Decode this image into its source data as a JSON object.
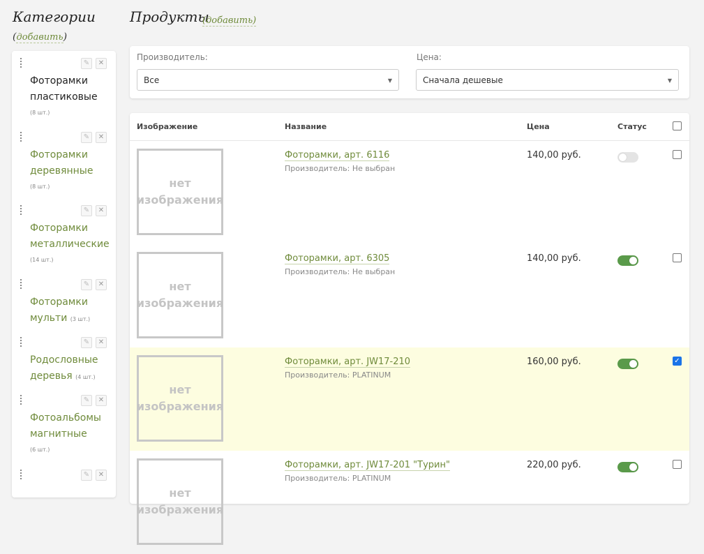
{
  "categories": {
    "title": "Категории",
    "add_open": "(",
    "add_label": "добавить",
    "add_close": ")",
    "items": [
      {
        "line1": "Фоторамки",
        "line2": "пластиковые",
        "inline_count": "",
        "count": "(8 шт.)",
        "active": true
      },
      {
        "line1": "Фоторамки",
        "line2": "деревянные",
        "inline_count": "",
        "count": "(8 шт.)",
        "active": false
      },
      {
        "line1": "Фоторамки",
        "line2": "металлические",
        "inline_count": "",
        "count": "(14 шт.)",
        "active": false
      },
      {
        "line1": "Фоторамки",
        "line2": "мульти",
        "inline_count": "(3 шт.)",
        "count": "",
        "active": false
      },
      {
        "line1": "Родословные",
        "line2": "деревья",
        "inline_count": "(4 шт.)",
        "count": "",
        "active": false
      },
      {
        "line1": "Фотоальбомы",
        "line2": "магнитные",
        "inline_count": "",
        "count": "(6 шт.)",
        "active": false
      }
    ],
    "edit_icon": "pencil-icon",
    "delete_icon": "close-icon",
    "delete_glyph": "✕",
    "edit_glyph": "✎"
  },
  "products": {
    "title": "Продукты",
    "add_label": "(добавить)"
  },
  "filters": {
    "maker_label": "Производитель:",
    "maker_value": "Все",
    "price_label": "Цена:",
    "price_value": "Сначала дешевые",
    "arrow": "▼"
  },
  "table": {
    "col_image": "Изображение",
    "col_name": "Название",
    "col_price": "Цена",
    "col_status": "Статус",
    "no_image_line1": "нет",
    "no_image_line2": "изображения",
    "check_glyph": "✓",
    "rows": [
      {
        "name": "Фоторамки, арт. 6116",
        "maker": "Производитель: Не выбран",
        "price": "140,00 руб.",
        "status_on": false,
        "checked": false
      },
      {
        "name": "Фоторамки, арт. 6305",
        "maker": "Производитель: Не выбран",
        "price": "140,00 руб.",
        "status_on": true,
        "checked": false
      },
      {
        "name": "Фоторамки, арт. JW17-210",
        "maker": "Производитель: PLATINUM",
        "price": "160,00 руб.",
        "status_on": true,
        "checked": true
      },
      {
        "name": "Фоторамки, арт. JW17-201 \"Турин\"",
        "maker": "Производитель: PLATINUM",
        "price": "220,00 руб.",
        "status_on": true,
        "checked": false
      }
    ]
  },
  "colors": {
    "link": "#6f8b3b",
    "toggle_on": "#5a9a4a",
    "selected_row": "#fdfde0",
    "checkbox_checked": "#1a73e8"
  }
}
